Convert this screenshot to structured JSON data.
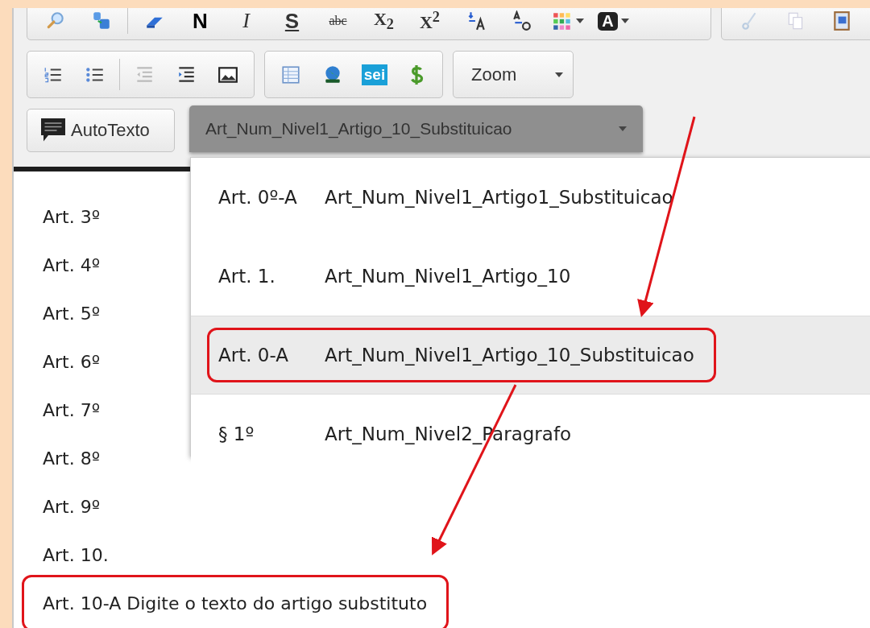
{
  "toolbar": {
    "bold": "N",
    "italic": "I",
    "underline": "S",
    "strikethrough": "abc",
    "subscript": "X$_{2}$",
    "superscript": "X$^{2}$",
    "text_color": "A",
    "logo": "sei",
    "zoom": "Zoom",
    "autotext": "AutoTexto",
    "style_select": "Art_Num_Nivel1_Artigo_10_Substituicao"
  },
  "style_menu": [
    {
      "number": "Art. 0º-A",
      "name": "Art_Num_Nivel1_Artigo1_Substituicao",
      "selected": false,
      "annotated": false
    },
    {
      "number": "Art. 1.",
      "name": "Art_Num_Nivel1_Artigo_10",
      "selected": false,
      "annotated": false
    },
    {
      "number": "Art. 0-A",
      "name": "Art_Num_Nivel1_Artigo_10_Substituicao",
      "selected": true,
      "annotated": true
    },
    {
      "number": "§ 1º",
      "name": "Art_Num_Nivel2_Paragrafo",
      "selected": false,
      "annotated": false
    }
  ],
  "document_lines": [
    {
      "text": "Art. 3º",
      "annotated": false
    },
    {
      "text": "Art. 4º",
      "annotated": false
    },
    {
      "text": "Art. 5º",
      "annotated": false
    },
    {
      "text": "Art. 6º",
      "annotated": false
    },
    {
      "text": "Art. 7º",
      "annotated": false
    },
    {
      "text": "Art. 8º",
      "annotated": false
    },
    {
      "text": "Art. 9º",
      "annotated": false
    },
    {
      "text": "Art. 10.",
      "annotated": false
    },
    {
      "text": "Art. 10-A Digite o texto do artigo substituto",
      "annotated": true
    }
  ]
}
